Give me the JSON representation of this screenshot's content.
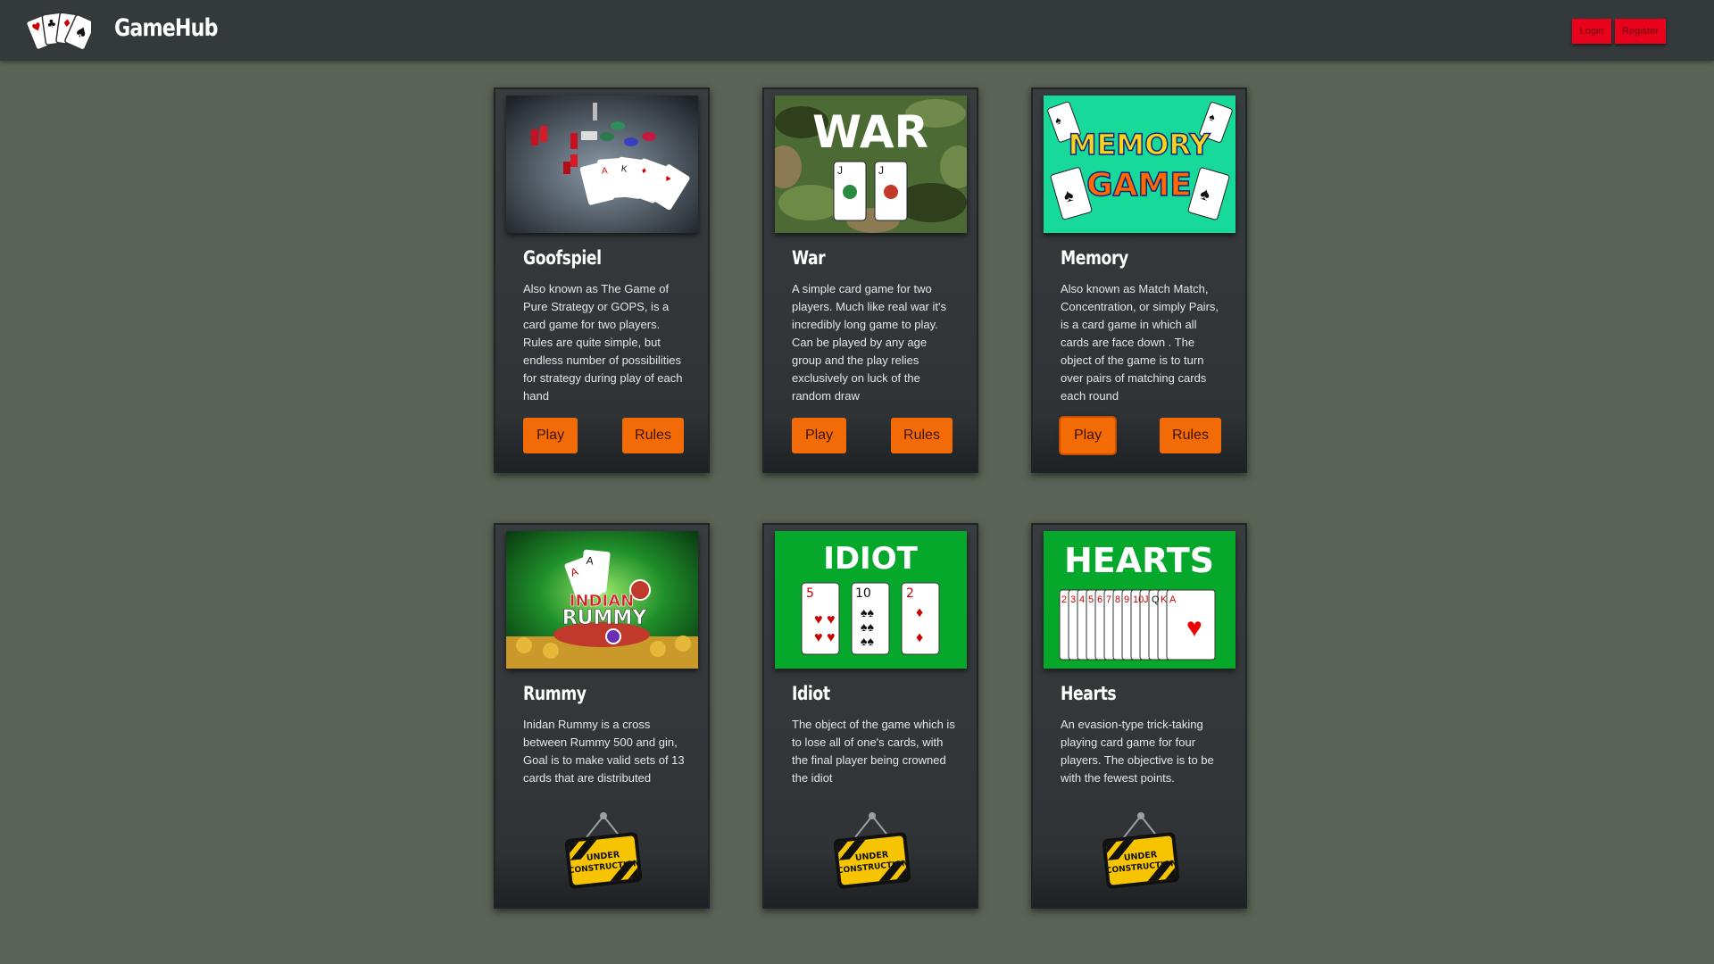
{
  "header": {
    "brand": "GameHub",
    "login_label": "Login",
    "register_label": "Register"
  },
  "games": [
    {
      "title": "Goofspiel",
      "description": "Also known as The Game of Pure Strategy or GOPS, is a card game for two players. Rules are quite simple, but endless number of possibilities for strategy during play of each hand",
      "play_label": "Play",
      "rules_label": "Rules"
    },
    {
      "title": "War",
      "thumb_text": "WAR",
      "description": "A simple card game for two players. Much like real war it's incredibly long game to play. Can be played by any age group and the play relies exclusively on luck of the random draw",
      "play_label": "Play",
      "rules_label": "Rules"
    },
    {
      "title": "Memory",
      "thumb_text_1": "MEMORY",
      "thumb_text_2": "GAME",
      "description": "Also known as Match Match, Concentration, or simply Pairs, is a card game in which all cards are face down . The object of the game is to turn over pairs of matching cards each round",
      "play_label": "Play",
      "rules_label": "Rules"
    },
    {
      "title": "Rummy",
      "thumb_text_1": "INDIAN",
      "thumb_text_2": "RUMMY",
      "description": "Inidan Rummy is a cross between Rummy 500 and gin, Goal is to make valid sets of 13 cards that are distributed",
      "status_sign_1": "UNDER",
      "status_sign_2": "CONSTRUCTION"
    },
    {
      "title": "Idiot",
      "thumb_text": "IDIOT",
      "description": "The object of the game which is to lose all of one's cards, with the final player being crowned the idiot",
      "status_sign_1": "UNDER",
      "status_sign_2": "CONSTRUCTION"
    },
    {
      "title": "Hearts",
      "thumb_text": "HEARTS",
      "description": "An evasion-type trick-taking playing card game for four players. The objective is to be with the fewest points.",
      "status_sign_1": "UNDER",
      "status_sign_2": "CONSTRUCTION"
    }
  ],
  "colors": {
    "page_background": "#5a6356",
    "navbar": "#34393b",
    "card": "#34383b",
    "button_accent": "#f26b07",
    "auth_button": "#e8021c"
  },
  "icons": [
    "playing-cards-logo-icon",
    "under-construction-sign-icon"
  ]
}
